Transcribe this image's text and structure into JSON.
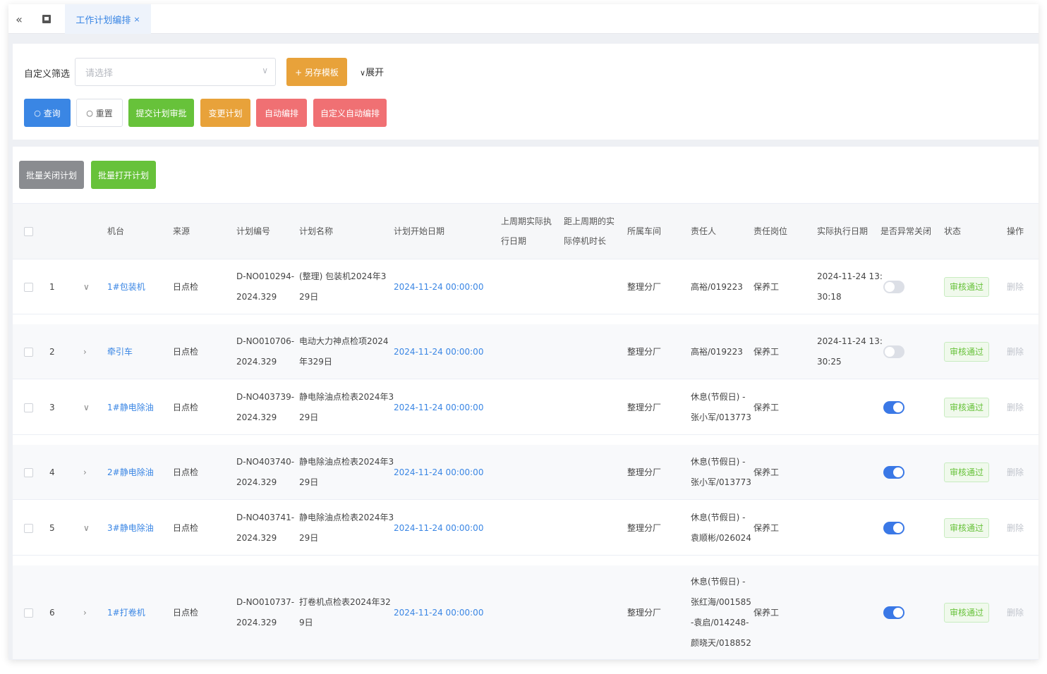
{
  "tabbar": {
    "back_icon": "«",
    "tab_label": "工作计划编排",
    "tab_close": "×"
  },
  "filter": {
    "label": "自定义筛选",
    "select_placeholder": "请选择",
    "save_template": "+ 另存模板",
    "expand": "展开",
    "buttons": {
      "query": "查询",
      "reset": "重置",
      "submit_review": "提交计划审批",
      "change_plan": "变更计划",
      "auto_arrange": "自动编排",
      "custom_auto_arrange": "自定义自动编排"
    }
  },
  "actions": {
    "batch_close": "批量关闭计划",
    "batch_open": "批量打开计划"
  },
  "colors": {
    "primary": "#3a86e4",
    "success_green": "#67c23a",
    "warning_orange": "#e8a23a",
    "danger_red": "#f07073",
    "gray_button": "#8a8c90"
  },
  "table": {
    "headers": {
      "machine": "机台",
      "source": "来源",
      "plan_no": "计划编号",
      "plan_name": "计划名称",
      "start_date": "计划开始日期",
      "last_exec_1": "上周期实际执",
      "last_exec_2": "行日期",
      "since_last_1": "距上周期的实",
      "since_last_2": "际停机时长",
      "workshop": "所属车间",
      "owner": "责任人",
      "post": "责任岗位",
      "actual_date": "实际执行日期",
      "abnormal_close": "是否异常关闭",
      "status": "状态",
      "operation": "操作"
    },
    "rows": [
      {
        "index": "1",
        "expand": "∨",
        "machine": "1#包装机",
        "source": "日点检",
        "plan_no_1": "D-NO010294-",
        "plan_no_2": "2024.329",
        "plan_name_1": "(整理) 包装机2024年3",
        "plan_name_2": "29日",
        "start_date": "2024-11-24 00:00:00",
        "workshop": "整理分厂",
        "owner_lines": [
          "高裕/019223"
        ],
        "post": "保养工",
        "actual_1": "2024-11-24 13:",
        "actual_2": "30:18",
        "abnormal": false,
        "status": "审核通过",
        "op": "删除"
      },
      {
        "index": "2",
        "expand": "›",
        "machine": "牵引车",
        "source": "日点检",
        "plan_no_1": "D-NO010706-",
        "plan_no_2": "2024.329",
        "plan_name_1": "电动大力神点检项2024",
        "plan_name_2": "年329日",
        "start_date": "2024-11-24 00:00:00",
        "workshop": "整理分厂",
        "owner_lines": [
          "高裕/019223"
        ],
        "post": "保养工",
        "actual_1": "2024-11-24 13:",
        "actual_2": "30:25",
        "abnormal": false,
        "status": "审核通过",
        "op": "删除"
      },
      {
        "index": "3",
        "expand": "∨",
        "machine": "1#静电除油",
        "source": "日点检",
        "plan_no_1": "D-NO403739-",
        "plan_no_2": "2024.329",
        "plan_name_1": "静电除油点检表2024年3",
        "plan_name_2": "29日",
        "start_date": "2024-11-24 00:00:00",
        "workshop": "整理分厂",
        "owner_lines": [
          "休息(节假日) -",
          "张小军/013773"
        ],
        "post": "保养工",
        "actual_1": "",
        "actual_2": "",
        "abnormal": true,
        "status": "审核通过",
        "op": "删除"
      },
      {
        "index": "4",
        "expand": "›",
        "machine": "2#静电除油",
        "source": "日点检",
        "plan_no_1": "D-NO403740-",
        "plan_no_2": "2024.329",
        "plan_name_1": "静电除油点检表2024年3",
        "plan_name_2": "29日",
        "start_date": "2024-11-24 00:00:00",
        "workshop": "整理分厂",
        "owner_lines": [
          "休息(节假日) -",
          "张小军/013773"
        ],
        "post": "保养工",
        "actual_1": "",
        "actual_2": "",
        "abnormal": true,
        "status": "审核通过",
        "op": "删除"
      },
      {
        "index": "5",
        "expand": "∨",
        "machine": "3#静电除油",
        "source": "日点检",
        "plan_no_1": "D-NO403741-",
        "plan_no_2": "2024.329",
        "plan_name_1": "静电除油点检表2024年3",
        "plan_name_2": "29日",
        "start_date": "2024-11-24 00:00:00",
        "workshop": "整理分厂",
        "owner_lines": [
          "休息(节假日) -",
          "袁顺彬/026024"
        ],
        "post": "保养工",
        "actual_1": "",
        "actual_2": "",
        "abnormal": true,
        "status": "审核通过",
        "op": "删除"
      },
      {
        "index": "6",
        "expand": "›",
        "machine": "1#打卷机",
        "source": "日点检",
        "plan_no_1": "D-NO010737-",
        "plan_no_2": "2024.329",
        "plan_name_1": "打卷机点检表2024年32",
        "plan_name_2": "9日",
        "start_date": "2024-11-24 00:00:00",
        "workshop": "整理分厂",
        "owner_lines": [
          "休息(节假日) -",
          "张红海/001585",
          "-袁启/014248-",
          "颜晓天/018852"
        ],
        "post": "保养工",
        "actual_1": "",
        "actual_2": "",
        "abnormal": true,
        "status": "审核通过",
        "op": "删除"
      }
    ]
  }
}
